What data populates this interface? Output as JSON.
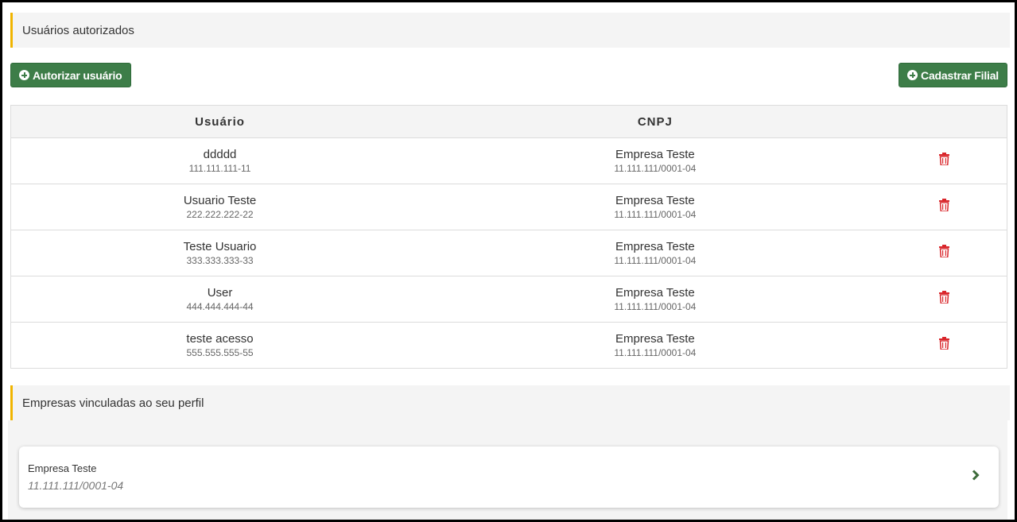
{
  "authorized_section": {
    "title": "Usuários autorizados"
  },
  "actions": {
    "authorize_label": "Autorizar usuário",
    "register_branch_label": "Cadastrar Filial"
  },
  "table": {
    "headers": {
      "user": "Usuário",
      "cnpj": "CNPJ"
    },
    "rows": [
      {
        "name": "ddddd",
        "cpf": "111.111.111-11",
        "company": "Empresa Teste",
        "cnpj": "11.111.111/0001-04"
      },
      {
        "name": "Usuario Teste",
        "cpf": "222.222.222-22",
        "company": "Empresa Teste",
        "cnpj": "11.111.111/0001-04"
      },
      {
        "name": "Teste Usuario",
        "cpf": "333.333.333-33",
        "company": "Empresa Teste",
        "cnpj": "11.111.111/0001-04"
      },
      {
        "name": "User",
        "cpf": "444.444.444-44",
        "company": "Empresa Teste",
        "cnpj": "11.111.111/0001-04"
      },
      {
        "name": "teste acesso",
        "cpf": "555.555.555-55",
        "company": "Empresa Teste",
        "cnpj": "11.111.111/0001-04"
      }
    ]
  },
  "companies_section": {
    "title": "Empresas vinculadas ao seu perfil",
    "items": [
      {
        "name": "Empresa Teste",
        "cnpj": "11.111.111/0001-04"
      }
    ]
  },
  "icons": {
    "add": "plus-circle-icon",
    "delete": "trash-icon",
    "open": "chevron-right-icon"
  },
  "colors": {
    "accent_bar": "#f0b400",
    "button_green": "#3d7d48",
    "delete_red": "#d9262b",
    "chevron_green": "#3d6b3a"
  }
}
